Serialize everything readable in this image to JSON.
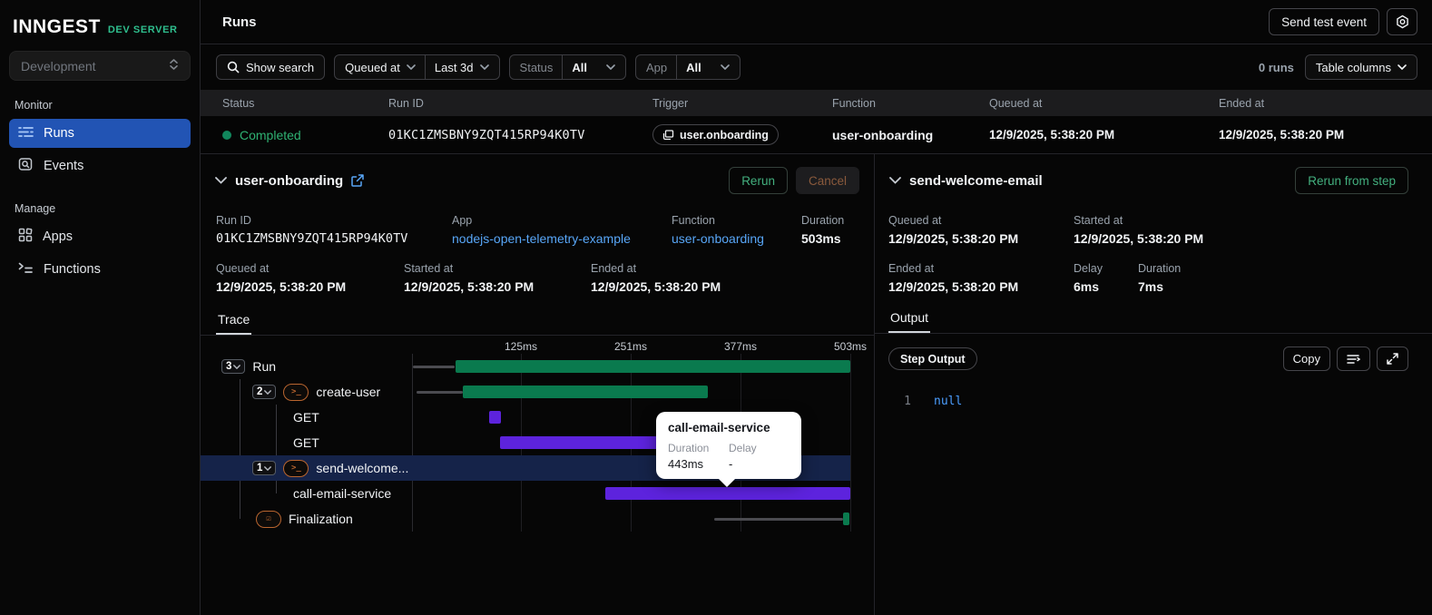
{
  "sidebar": {
    "logo": "INNGEST",
    "logo_suffix": "DEV SERVER",
    "env_select": "Development",
    "monitor_label": "Monitor",
    "items": [
      {
        "label": "Runs"
      },
      {
        "label": "Events"
      }
    ],
    "manage_label": "Manage",
    "manage_items": [
      {
        "label": "Apps"
      },
      {
        "label": "Functions"
      }
    ]
  },
  "topbar": {
    "title": "Runs",
    "send_test_event": "Send test event"
  },
  "filters": {
    "show_search": "Show search",
    "queued_at": "Queued at",
    "range": "Last 3d",
    "status_label": "Status",
    "status_value": "All",
    "app_label": "App",
    "app_value": "All",
    "runs_count": "0 runs",
    "table_columns": "Table columns"
  },
  "table": {
    "headers": {
      "status": "Status",
      "run_id": "Run ID",
      "trigger": "Trigger",
      "function": "Function",
      "queued_at": "Queued at",
      "ended_at": "Ended at"
    },
    "row": {
      "status": "Completed",
      "run_id": "01KC1ZMSBNY9ZQT415RP94K0TV",
      "trigger": "user.onboarding",
      "function": "user-onboarding",
      "queued_at": "12/9/2025, 5:38:20 PM",
      "ended_at": "12/9/2025, 5:38:20 PM"
    }
  },
  "run_detail": {
    "title": "user-onboarding",
    "rerun": "Rerun",
    "cancel": "Cancel",
    "run_id_label": "Run ID",
    "run_id": "01KC1ZMSBNY9ZQT415RP94K0TV",
    "app_label": "App",
    "app": "nodejs-open-telemetry-example",
    "function_label": "Function",
    "function": "user-onboarding",
    "duration_label": "Duration",
    "duration": "503ms",
    "queued_label": "Queued at",
    "queued_at": "12/9/2025, 5:38:20 PM",
    "started_label": "Started at",
    "started_at": "12/9/2025, 5:38:20 PM",
    "ended_label": "Ended at",
    "ended_at": "12/9/2025, 5:38:20 PM",
    "trace_tab": "Trace"
  },
  "chart_data": {
    "type": "waterfall-trace",
    "unit": "ms",
    "total_ms": 503,
    "ticks": [
      {
        "ms": 125,
        "label": "125ms"
      },
      {
        "ms": 251,
        "label": "251ms"
      },
      {
        "ms": 377,
        "label": "377ms"
      },
      {
        "ms": 503,
        "label": "503ms"
      }
    ],
    "rows": [
      {
        "name": "Run",
        "badge": "3",
        "icon": null,
        "pad": 23,
        "lead": [
          1,
          49
        ],
        "bar": [
          50,
          503
        ],
        "color": "green",
        "selected": false
      },
      {
        "name": "create-user",
        "badge": "2",
        "icon": "terminal",
        "pad": 57,
        "lead": [
          5,
          58
        ],
        "bar": [
          58,
          339
        ],
        "color": "green",
        "selected": false
      },
      {
        "name": "GET",
        "badge": null,
        "icon": null,
        "pad": 102,
        "lead": null,
        "bar": [
          88,
          102
        ],
        "color": "purple",
        "selected": false
      },
      {
        "name": "GET",
        "badge": null,
        "icon": null,
        "pad": 102,
        "lead": null,
        "bar": [
          101,
          285
        ],
        "color": "purple",
        "selected": false
      },
      {
        "name": "send-welcome...",
        "badge": "1",
        "icon": "terminal",
        "pad": 57,
        "lead": [
          334,
          341
        ],
        "bar": [
          341,
          348
        ],
        "color": "green",
        "selected": true
      },
      {
        "name": "call-email-service",
        "badge": null,
        "icon": null,
        "pad": 102,
        "lead": null,
        "bar": [
          222,
          503
        ],
        "color": "purple",
        "selected": false
      },
      {
        "name": "Finalization",
        "badge": null,
        "icon": "check",
        "pad": 61,
        "lead": [
          347,
          495
        ],
        "bar": [
          495,
          502
        ],
        "color": "green",
        "selected": false
      }
    ],
    "tooltip": {
      "title": "call-email-service",
      "duration_label": "Duration",
      "delay_label": "Delay",
      "duration": "443ms",
      "delay": "-"
    }
  },
  "step_detail": {
    "title": "send-welcome-email",
    "rerun_from_step": "Rerun from step",
    "queued_label": "Queued at",
    "queued_at": "12/9/2025, 5:38:20 PM",
    "started_label": "Started at",
    "started_at": "12/9/2025, 5:38:20 PM",
    "ended_label": "Ended at",
    "ended_at": "12/9/2025, 5:38:20 PM",
    "delay_label": "Delay",
    "delay": "6ms",
    "duration_label": "Duration",
    "duration": "7ms",
    "output_tab": "Output",
    "step_output_badge": "Step Output",
    "copy": "Copy",
    "code_line_number": "1",
    "code_value": "null"
  },
  "colors": {
    "bar_green": "#0a7a4e",
    "bar_purple": "#5d23dd",
    "selected_row": "#152349",
    "nav_active": "#2254b4",
    "link_blue": "#58a6f7",
    "status_green": "#2fb273",
    "brand_green": "#2fbf8e",
    "rerun_green": "#43b07f",
    "cancel_disabled": "#8a5a3c",
    "step_icon_orange": "#b9652f",
    "null_blue": "#4b9eff"
  },
  "icons": {
    "search": "search-icon",
    "gear": "gear-icon",
    "chevron": "chevron-down-icon",
    "external": "external-link-icon",
    "trigger": "event-window-icon",
    "wrap": "word-wrap-icon",
    "expand": "expand-icon"
  }
}
